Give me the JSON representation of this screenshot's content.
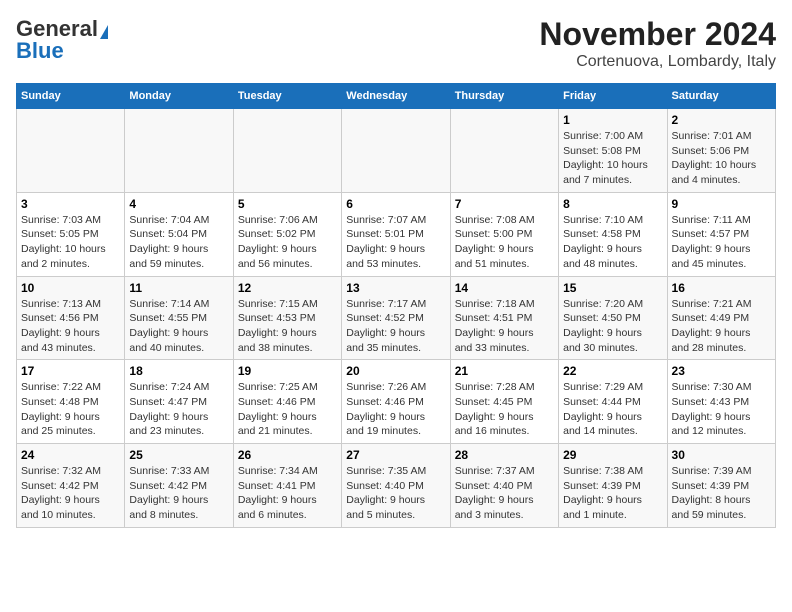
{
  "header": {
    "logo_line1": "General",
    "logo_line2": "Blue",
    "title": "November 2024",
    "subtitle": "Cortenuova, Lombardy, Italy"
  },
  "columns": [
    "Sunday",
    "Monday",
    "Tuesday",
    "Wednesday",
    "Thursday",
    "Friday",
    "Saturday"
  ],
  "weeks": [
    [
      {
        "day": "",
        "info": ""
      },
      {
        "day": "",
        "info": ""
      },
      {
        "day": "",
        "info": ""
      },
      {
        "day": "",
        "info": ""
      },
      {
        "day": "",
        "info": ""
      },
      {
        "day": "1",
        "info": "Sunrise: 7:00 AM\nSunset: 5:08 PM\nDaylight: 10 hours\nand 7 minutes."
      },
      {
        "day": "2",
        "info": "Sunrise: 7:01 AM\nSunset: 5:06 PM\nDaylight: 10 hours\nand 4 minutes."
      }
    ],
    [
      {
        "day": "3",
        "info": "Sunrise: 7:03 AM\nSunset: 5:05 PM\nDaylight: 10 hours\nand 2 minutes."
      },
      {
        "day": "4",
        "info": "Sunrise: 7:04 AM\nSunset: 5:04 PM\nDaylight: 9 hours\nand 59 minutes."
      },
      {
        "day": "5",
        "info": "Sunrise: 7:06 AM\nSunset: 5:02 PM\nDaylight: 9 hours\nand 56 minutes."
      },
      {
        "day": "6",
        "info": "Sunrise: 7:07 AM\nSunset: 5:01 PM\nDaylight: 9 hours\nand 53 minutes."
      },
      {
        "day": "7",
        "info": "Sunrise: 7:08 AM\nSunset: 5:00 PM\nDaylight: 9 hours\nand 51 minutes."
      },
      {
        "day": "8",
        "info": "Sunrise: 7:10 AM\nSunset: 4:58 PM\nDaylight: 9 hours\nand 48 minutes."
      },
      {
        "day": "9",
        "info": "Sunrise: 7:11 AM\nSunset: 4:57 PM\nDaylight: 9 hours\nand 45 minutes."
      }
    ],
    [
      {
        "day": "10",
        "info": "Sunrise: 7:13 AM\nSunset: 4:56 PM\nDaylight: 9 hours\nand 43 minutes."
      },
      {
        "day": "11",
        "info": "Sunrise: 7:14 AM\nSunset: 4:55 PM\nDaylight: 9 hours\nand 40 minutes."
      },
      {
        "day": "12",
        "info": "Sunrise: 7:15 AM\nSunset: 4:53 PM\nDaylight: 9 hours\nand 38 minutes."
      },
      {
        "day": "13",
        "info": "Sunrise: 7:17 AM\nSunset: 4:52 PM\nDaylight: 9 hours\nand 35 minutes."
      },
      {
        "day": "14",
        "info": "Sunrise: 7:18 AM\nSunset: 4:51 PM\nDaylight: 9 hours\nand 33 minutes."
      },
      {
        "day": "15",
        "info": "Sunrise: 7:20 AM\nSunset: 4:50 PM\nDaylight: 9 hours\nand 30 minutes."
      },
      {
        "day": "16",
        "info": "Sunrise: 7:21 AM\nSunset: 4:49 PM\nDaylight: 9 hours\nand 28 minutes."
      }
    ],
    [
      {
        "day": "17",
        "info": "Sunrise: 7:22 AM\nSunset: 4:48 PM\nDaylight: 9 hours\nand 25 minutes."
      },
      {
        "day": "18",
        "info": "Sunrise: 7:24 AM\nSunset: 4:47 PM\nDaylight: 9 hours\nand 23 minutes."
      },
      {
        "day": "19",
        "info": "Sunrise: 7:25 AM\nSunset: 4:46 PM\nDaylight: 9 hours\nand 21 minutes."
      },
      {
        "day": "20",
        "info": "Sunrise: 7:26 AM\nSunset: 4:46 PM\nDaylight: 9 hours\nand 19 minutes."
      },
      {
        "day": "21",
        "info": "Sunrise: 7:28 AM\nSunset: 4:45 PM\nDaylight: 9 hours\nand 16 minutes."
      },
      {
        "day": "22",
        "info": "Sunrise: 7:29 AM\nSunset: 4:44 PM\nDaylight: 9 hours\nand 14 minutes."
      },
      {
        "day": "23",
        "info": "Sunrise: 7:30 AM\nSunset: 4:43 PM\nDaylight: 9 hours\nand 12 minutes."
      }
    ],
    [
      {
        "day": "24",
        "info": "Sunrise: 7:32 AM\nSunset: 4:42 PM\nDaylight: 9 hours\nand 10 minutes."
      },
      {
        "day": "25",
        "info": "Sunrise: 7:33 AM\nSunset: 4:42 PM\nDaylight: 9 hours\nand 8 minutes."
      },
      {
        "day": "26",
        "info": "Sunrise: 7:34 AM\nSunset: 4:41 PM\nDaylight: 9 hours\nand 6 minutes."
      },
      {
        "day": "27",
        "info": "Sunrise: 7:35 AM\nSunset: 4:40 PM\nDaylight: 9 hours\nand 5 minutes."
      },
      {
        "day": "28",
        "info": "Sunrise: 7:37 AM\nSunset: 4:40 PM\nDaylight: 9 hours\nand 3 minutes."
      },
      {
        "day": "29",
        "info": "Sunrise: 7:38 AM\nSunset: 4:39 PM\nDaylight: 9 hours\nand 1 minute."
      },
      {
        "day": "30",
        "info": "Sunrise: 7:39 AM\nSunset: 4:39 PM\nDaylight: 8 hours\nand 59 minutes."
      }
    ]
  ]
}
